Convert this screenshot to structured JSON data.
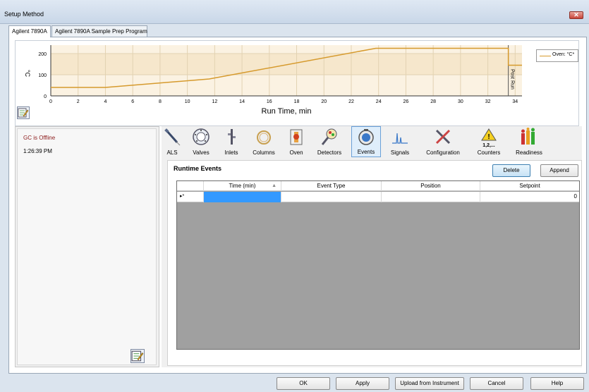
{
  "window": {
    "title": "Setup Method",
    "close_glyph": "✕"
  },
  "tabs": [
    {
      "label": "Agilent 7890A",
      "active": true
    },
    {
      "label": "Agilent 7890A Sample Prep Program",
      "active": false
    }
  ],
  "chart_data": {
    "type": "line",
    "xlabel": "Run Time, min",
    "ylabel": "°C",
    "x_ticks": [
      "0",
      "2",
      "4",
      "6",
      "8",
      "10",
      "12",
      "14",
      "16",
      "18",
      "20",
      "22",
      "24",
      "26",
      "28",
      "30",
      "32",
      "34"
    ],
    "y_ticks": [
      "0",
      "100",
      "200"
    ],
    "xlim": [
      0,
      34.5
    ],
    "ylim": [
      0,
      240
    ],
    "series": [
      {
        "name": "Oven: °C*",
        "color": "#d69a2d",
        "x": [
          0,
          4,
          11.6,
          23.8,
          33.5,
          33.5,
          34.5
        ],
        "y": [
          40,
          40,
          80,
          225,
          225,
          145,
          145
        ]
      }
    ],
    "post_run_label": "Post Run",
    "legend_position": "top-right",
    "grid": true
  },
  "status": {
    "offline": "GC is Offline",
    "time": "1:26:39 PM"
  },
  "toolbar": [
    {
      "label": "ALS",
      "icon": "syringe-icon"
    },
    {
      "label": "Valves",
      "icon": "valve-icon"
    },
    {
      "label": "Inlets",
      "icon": "inlet-icon"
    },
    {
      "label": "Columns",
      "icon": "column-icon"
    },
    {
      "label": "Oven",
      "icon": "oven-icon"
    },
    {
      "label": "Detectors",
      "icon": "detector-icon"
    },
    {
      "label": "Events",
      "icon": "events-icon",
      "selected": true
    },
    {
      "label": "Signals",
      "icon": "signals-icon"
    },
    {
      "label": "Configuration",
      "icon": "configuration-icon"
    },
    {
      "label": "Counters",
      "icon": "counters-icon",
      "sublabel": "1,2,..."
    },
    {
      "label": "Readiness",
      "icon": "readiness-icon"
    }
  ],
  "events": {
    "title": "Runtime Events",
    "delete_label": "Delete",
    "append_label": "Append",
    "columns": [
      "Time (min)",
      "Event Type",
      "Position",
      "Setpoint"
    ],
    "row_marker": "▸*",
    "rows": [
      {
        "time": "",
        "event_type": "",
        "position": "",
        "setpoint": "0"
      }
    ]
  },
  "footer": {
    "ok": "OK",
    "apply": "Apply",
    "upload": "Upload from Instrument",
    "cancel": "Cancel",
    "help": "Help"
  },
  "colors": {
    "accent": "#d69a2d",
    "offline": "#8b1a1a",
    "selection": "#3399ff"
  }
}
